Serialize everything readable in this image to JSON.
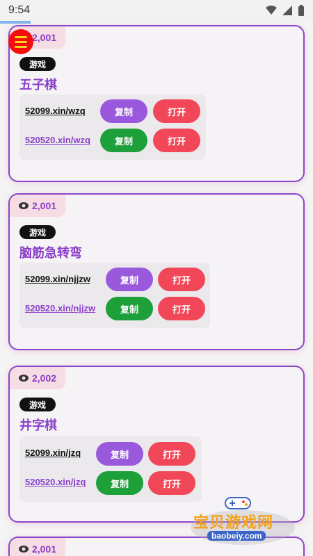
{
  "status": {
    "time": "9:54"
  },
  "cards": [
    {
      "views": "2,001",
      "tag": "游戏",
      "title": "五子棋",
      "link1": "52099.xin/wzq",
      "link2": "520520.xin/wzq",
      "copy": "复制",
      "open": "打开"
    },
    {
      "views": "2,001",
      "tag": "游戏",
      "title": "脑筋急转弯",
      "link1": "52099.xin/njjzw",
      "link2": "520520.xin/njjzw",
      "copy": "复制",
      "open": "打开"
    },
    {
      "views": "2,002",
      "tag": "游戏",
      "title": "井字棋",
      "link1": "52099.xin/jzq",
      "link2": "520520.xin/jzq",
      "copy": "复制",
      "open": "打开"
    },
    {
      "views": "2,001"
    }
  ],
  "watermark": {
    "title": "宝贝游戏网",
    "url": "baobeiy.com"
  },
  "colors": {
    "accent": "#8b3fc9",
    "copy_purple": "#9a58dc",
    "copy_green": "#1d9f39",
    "open_red": "#f14758",
    "menu_red": "#f50d0d"
  }
}
